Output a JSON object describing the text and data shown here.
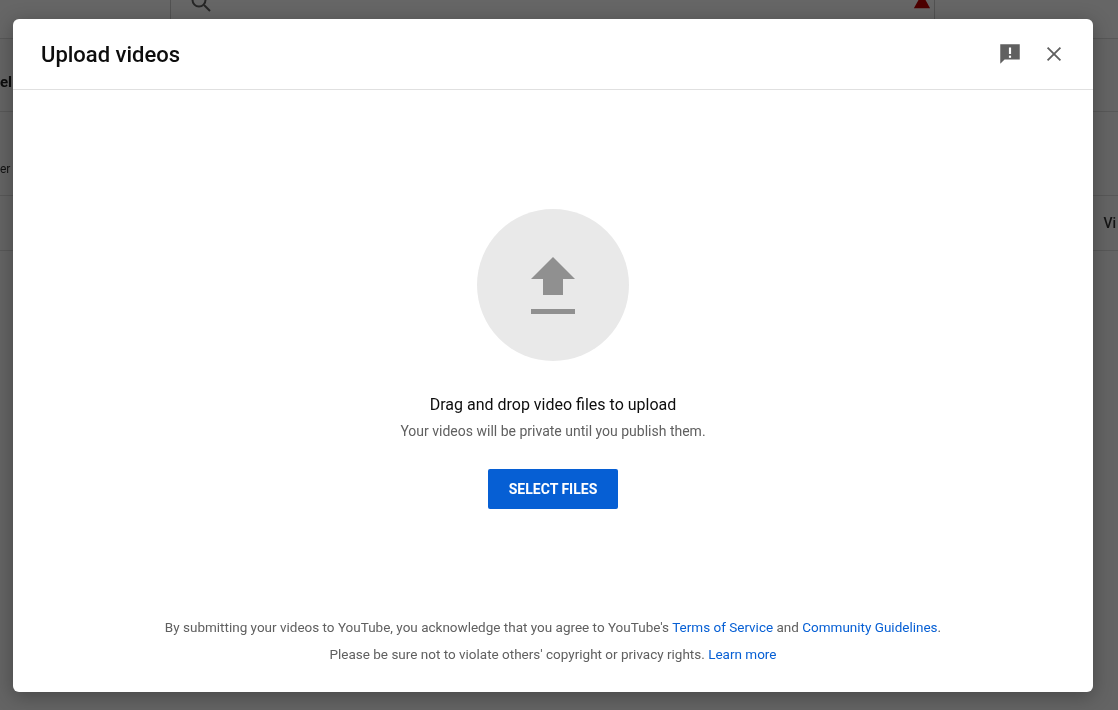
{
  "background_page": {
    "heading_fragment": "el",
    "row_fragment": "er",
    "column_fragment": "Vi"
  },
  "dialog": {
    "title": "Upload videos",
    "prompt": "Drag and drop video files to upload",
    "note": "Your videos will be private until you publish them.",
    "button": "SELECT FILES",
    "footer": [
      {
        "parts": [
          {
            "kind": "text",
            "text": "By submitting your videos to YouTube, you acknowledge that you agree to YouTube's "
          },
          {
            "kind": "link",
            "text": "Terms of Service"
          },
          {
            "kind": "text",
            "text": " and "
          },
          {
            "kind": "link",
            "text": "Community Guidelines"
          },
          {
            "kind": "text",
            "text": "."
          }
        ]
      },
      {
        "parts": [
          {
            "kind": "text",
            "text": "Please be sure not to violate others' copyright or privacy rights. "
          },
          {
            "kind": "link",
            "text": "Learn more"
          }
        ]
      }
    ]
  }
}
